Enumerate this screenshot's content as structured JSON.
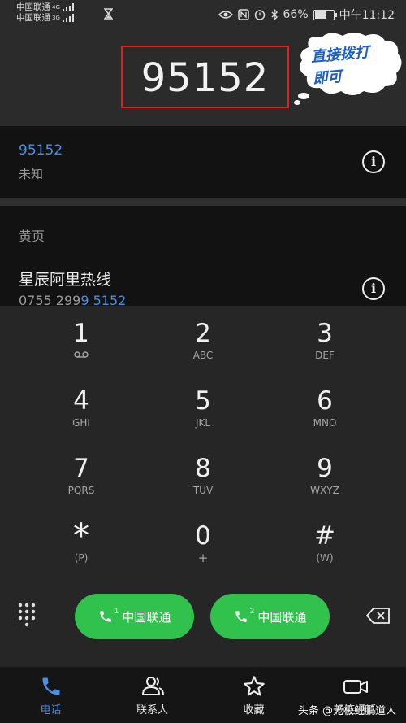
{
  "status_bar": {
    "carrier_1": "中国联通",
    "carrier_2": "中国联通",
    "net_1": "4G",
    "net_2": "3G",
    "battery": "66%",
    "battery_level": 0.66,
    "time": "中午11:12"
  },
  "dialer": {
    "entered_number": "95152"
  },
  "annotation": {
    "line1": "直接拨打",
    "line2": "即可",
    "box_color": "#e0221c"
  },
  "result": {
    "number": "95152",
    "subtitle": "未知"
  },
  "yellow_pages": {
    "section_label": "黄页",
    "entry_name": "星辰阿里热线",
    "entry_phone_prefix": "0755 299",
    "entry_phone_match": "9 5152"
  },
  "keypad": {
    "keys": [
      {
        "digit": "1",
        "letters": ""
      },
      {
        "digit": "2",
        "letters": "ABC"
      },
      {
        "digit": "3",
        "letters": "DEF"
      },
      {
        "digit": "4",
        "letters": "GHI"
      },
      {
        "digit": "5",
        "letters": "JKL"
      },
      {
        "digit": "6",
        "letters": "MNO"
      },
      {
        "digit": "7",
        "letters": "PQRS"
      },
      {
        "digit": "8",
        "letters": "TUV"
      },
      {
        "digit": "9",
        "letters": "WXYZ"
      },
      {
        "digit": "*",
        "letters": "(P)"
      },
      {
        "digit": "0",
        "letters": "+"
      },
      {
        "digit": "#",
        "letters": "(W)"
      }
    ],
    "call_sim1": {
      "sim": "1",
      "label": "中国联通"
    },
    "call_sim2": {
      "sim": "2",
      "label": "中国联通"
    }
  },
  "nav": {
    "tabs": [
      {
        "label": "电话",
        "icon": "phone-icon",
        "active": true
      },
      {
        "label": "联系人",
        "icon": "contacts-icon",
        "active": false
      },
      {
        "label": "收藏",
        "icon": "star-icon",
        "active": false
      },
      {
        "label": "畅连通话",
        "icon": "video-call-icon",
        "active": false
      }
    ]
  },
  "watermark": "头条 @无极鲤鹏道人",
  "colors": {
    "accent": "#4b8fe0",
    "call_green": "#31c24e",
    "annotation_blue": "#1b5fc1"
  }
}
